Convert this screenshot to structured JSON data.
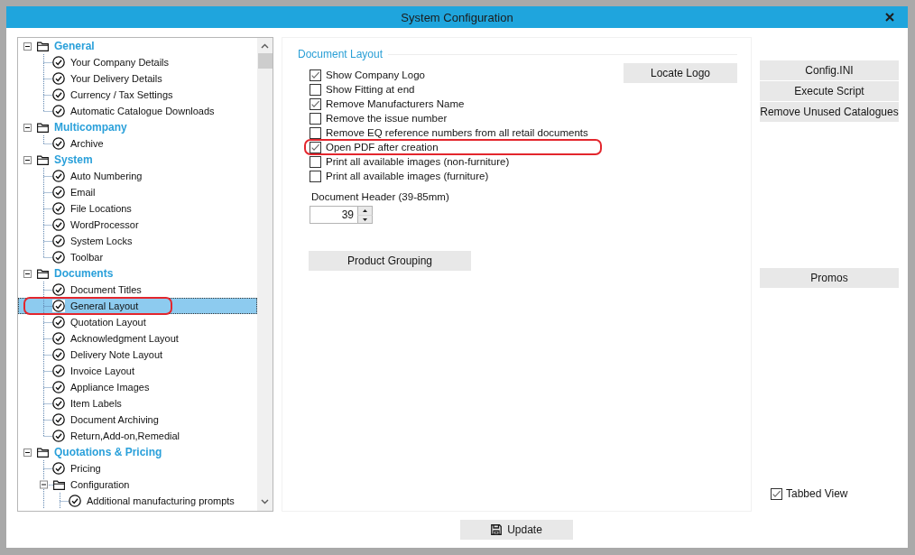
{
  "window": {
    "title": "System Configuration"
  },
  "tree": {
    "nodes": [
      {
        "kind": "folder",
        "label": "General",
        "expanded": true,
        "selected": false,
        "circled": false,
        "children": [
          {
            "kind": "page",
            "label": "Your Company Details",
            "selected": false,
            "circled": false
          },
          {
            "kind": "page",
            "label": "Your Delivery Details",
            "selected": false,
            "circled": false
          },
          {
            "kind": "page",
            "label": "Currency / Tax Settings",
            "selected": false,
            "circled": false
          },
          {
            "kind": "page",
            "label": "Automatic Catalogue Downloads",
            "selected": false,
            "circled": false
          }
        ]
      },
      {
        "kind": "folder",
        "label": "Multicompany",
        "expanded": true,
        "selected": false,
        "circled": false,
        "children": [
          {
            "kind": "page",
            "label": "Archive",
            "selected": false,
            "circled": false
          }
        ]
      },
      {
        "kind": "folder",
        "label": "System",
        "expanded": true,
        "selected": false,
        "circled": false,
        "children": [
          {
            "kind": "page",
            "label": "Auto Numbering",
            "selected": false,
            "circled": false
          },
          {
            "kind": "page",
            "label": "Email",
            "selected": false,
            "circled": false
          },
          {
            "kind": "page",
            "label": "File Locations",
            "selected": false,
            "circled": false
          },
          {
            "kind": "page",
            "label": "WordProcessor",
            "selected": false,
            "circled": false
          },
          {
            "kind": "page",
            "label": "System Locks",
            "selected": false,
            "circled": false
          },
          {
            "kind": "page",
            "label": "Toolbar",
            "selected": false,
            "circled": false
          }
        ]
      },
      {
        "kind": "folder",
        "label": "Documents",
        "expanded": true,
        "selected": false,
        "circled": false,
        "children": [
          {
            "kind": "page",
            "label": "Document Titles",
            "selected": false,
            "circled": false
          },
          {
            "kind": "page",
            "label": "General Layout",
            "selected": true,
            "circled": true
          },
          {
            "kind": "page",
            "label": "Quotation Layout",
            "selected": false,
            "circled": false
          },
          {
            "kind": "page",
            "label": "Acknowledgment Layout",
            "selected": false,
            "circled": false
          },
          {
            "kind": "page",
            "label": "Delivery Note Layout",
            "selected": false,
            "circled": false
          },
          {
            "kind": "page",
            "label": "Invoice Layout",
            "selected": false,
            "circled": false
          },
          {
            "kind": "page",
            "label": "Appliance Images",
            "selected": false,
            "circled": false
          },
          {
            "kind": "page",
            "label": "Item Labels",
            "selected": false,
            "circled": false
          },
          {
            "kind": "page",
            "label": "Document Archiving",
            "selected": false,
            "circled": false
          },
          {
            "kind": "page",
            "label": "Return,Add-on,Remedial",
            "selected": false,
            "circled": false
          }
        ]
      },
      {
        "kind": "folder",
        "label": "Quotations & Pricing",
        "expanded": true,
        "selected": false,
        "circled": false,
        "children": [
          {
            "kind": "page",
            "label": "Pricing",
            "selected": false,
            "circled": false
          },
          {
            "kind": "folder",
            "label": "Configuration",
            "expanded": true,
            "selected": false,
            "circled": false,
            "children": [
              {
                "kind": "page",
                "label": "Additional manufacturing prompts",
                "selected": false,
                "circled": false
              }
            ]
          }
        ]
      }
    ]
  },
  "document_layout": {
    "title": "Document Layout",
    "options": [
      {
        "label": "Show Company Logo",
        "checked": true,
        "circled": false
      },
      {
        "label": "Show Fitting at end",
        "checked": false,
        "circled": false
      },
      {
        "label": "Remove Manufacturers Name",
        "checked": true,
        "circled": false
      },
      {
        "label": "Remove the issue number",
        "checked": false,
        "circled": false
      },
      {
        "label": "Remove EQ reference numbers from all retail documents",
        "checked": false,
        "circled": false
      },
      {
        "label": "Open PDF after creation",
        "checked": true,
        "circled": true
      },
      {
        "label": "Print all available images (non-furniture)",
        "checked": false,
        "circled": false
      },
      {
        "label": "Print all available images (furniture)",
        "checked": false,
        "circled": false
      }
    ],
    "locate_logo_button": "Locate Logo",
    "header_height": {
      "label": "Document Header (39-85mm)",
      "value": "39"
    },
    "product_grouping_button": "Product Grouping"
  },
  "side_panel": {
    "buttons": [
      "Config.INI",
      "Execute Script",
      "Remove Unused Catalogues"
    ],
    "promos_button": "Promos",
    "tabbed_view": {
      "label": "Tabbed View",
      "checked": true
    }
  },
  "update_button": "Update"
}
